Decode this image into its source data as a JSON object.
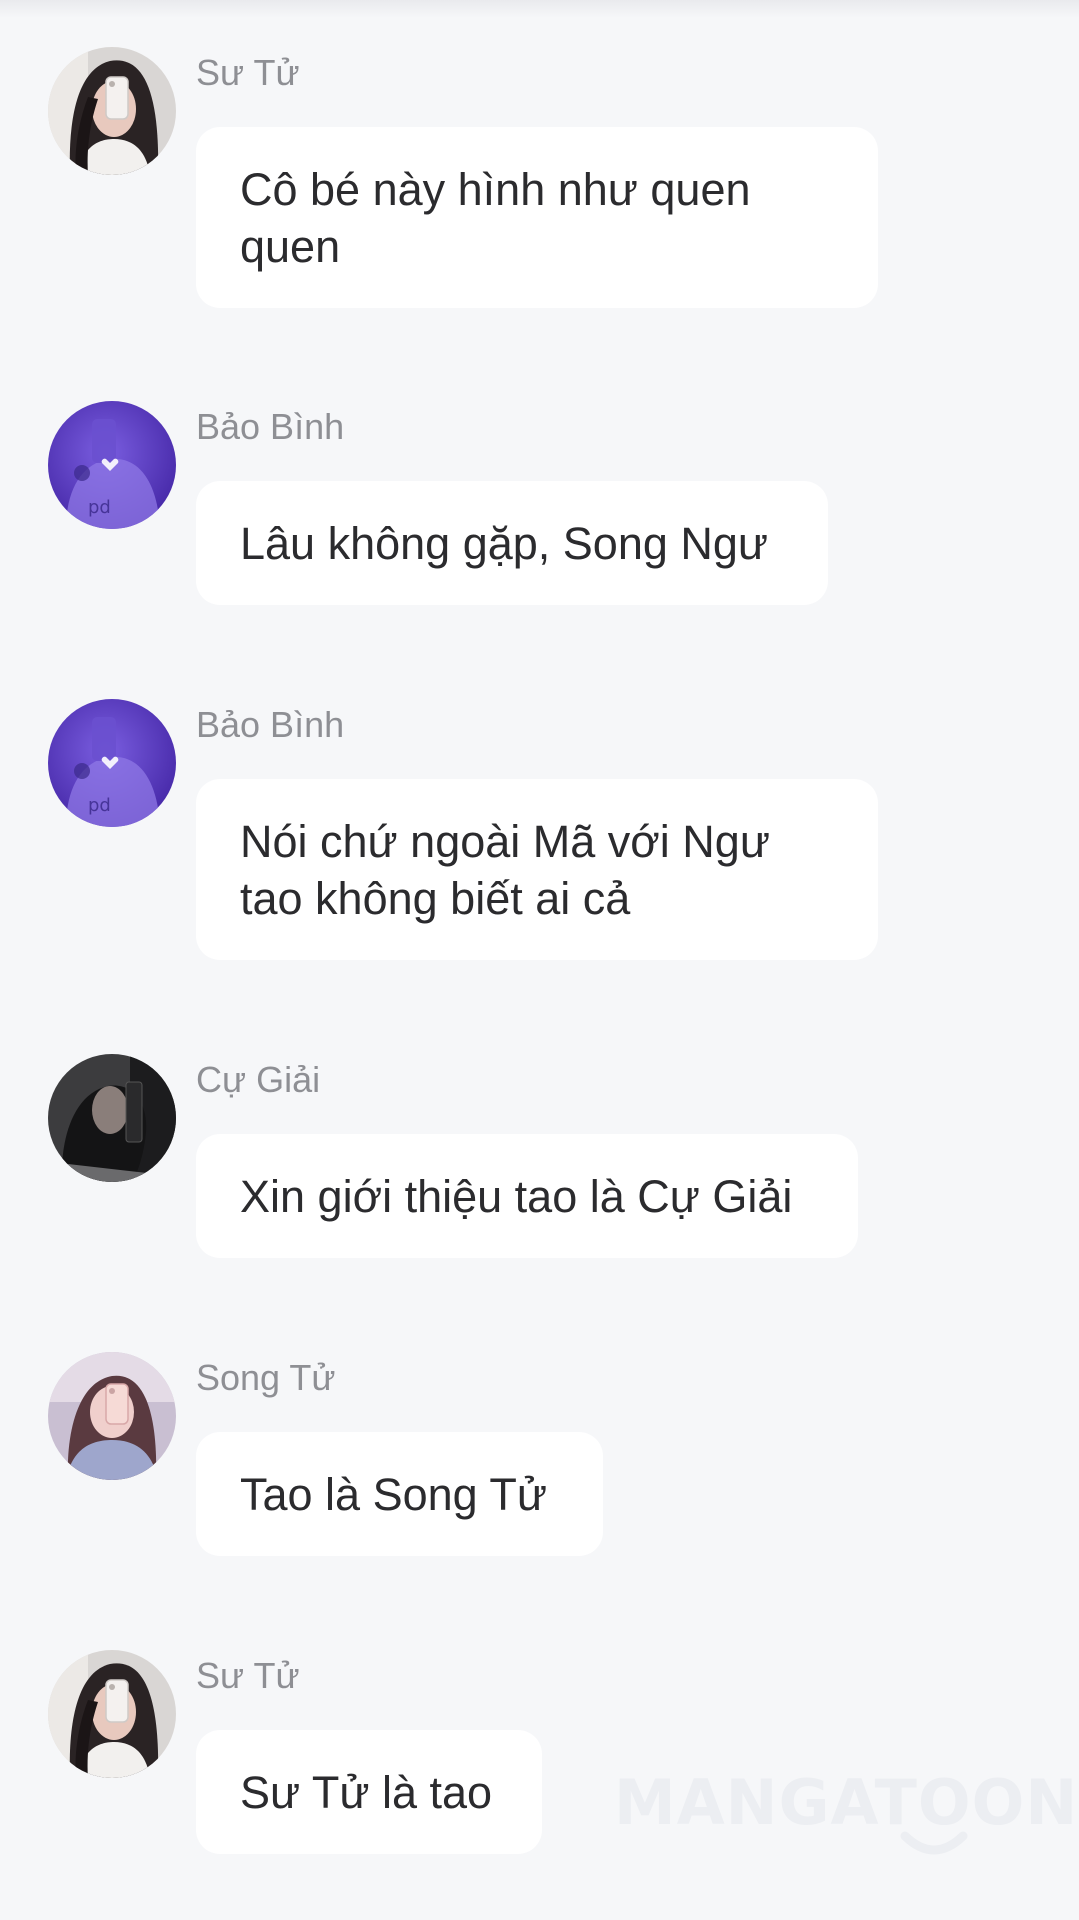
{
  "messages": [
    {
      "sender": "Sư Tử",
      "text": "Cô bé này hình như quen quen",
      "avatar": "long-dark-hair-selfie-avatar"
    },
    {
      "sender": "Bảo Bình",
      "text": "Lâu không gặp, Song Ngư",
      "avatar": "purple-tinted-selfie-avatar"
    },
    {
      "sender": "Bảo Bình",
      "text": "Nói chứ ngoài Mã với Ngư tao không biết ai cả",
      "avatar": "purple-tinted-selfie-avatar"
    },
    {
      "sender": "Cự Giải",
      "text": "Xin giới thiệu tao là Cự Giải",
      "avatar": "dark-profile-avatar"
    },
    {
      "sender": "Song Tử",
      "text": "Tao là Song Tử",
      "avatar": "pink-selfie-avatar"
    },
    {
      "sender": "Sư Tử",
      "text": "Sư Tử là tao",
      "avatar": "long-dark-hair-selfie-avatar"
    }
  ],
  "watermark": "MANGATOON",
  "colors": {
    "background": "#f6f7f9",
    "bubble": "#ffffff",
    "sender_name": "#8e8f94",
    "message_text": "#2b2b2e",
    "avatar_purple": "#5a3bc4"
  }
}
